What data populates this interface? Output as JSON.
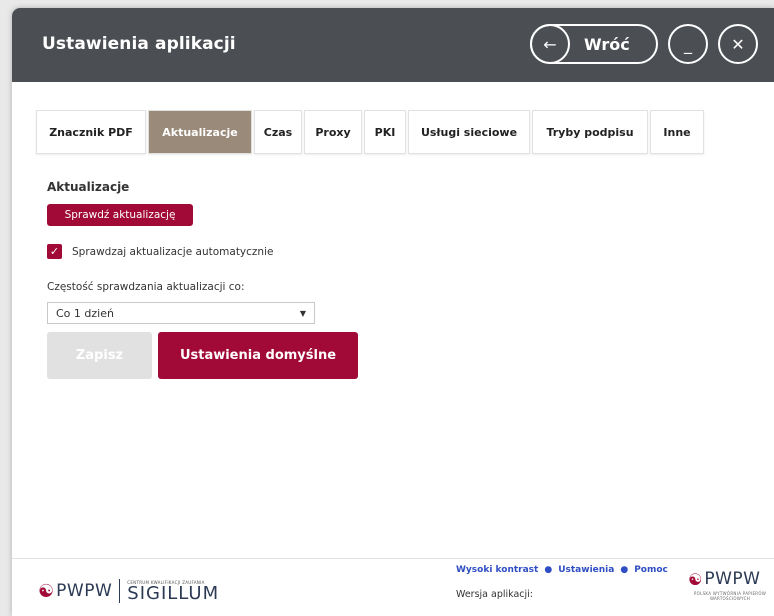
{
  "titlebar": {
    "title": "Ustawienia aplikacji",
    "back_label": "Wróć",
    "back_icon": "arrow-left-icon",
    "minimize_icon": "minimize-icon",
    "close_icon": "close-icon"
  },
  "tabs": [
    {
      "label": "Znacznik PDF",
      "active": false
    },
    {
      "label": "Aktualizacje",
      "active": true
    },
    {
      "label": "Czas",
      "active": false
    },
    {
      "label": "Proxy",
      "active": false
    },
    {
      "label": "PKI",
      "active": false
    },
    {
      "label": "Usługi sieciowe",
      "active": false
    },
    {
      "label": "Tryby podpisu",
      "active": false
    },
    {
      "label": "Inne",
      "active": false
    }
  ],
  "updates": {
    "section_title": "Aktualizacje",
    "check_button": "Sprawdź aktualizację",
    "auto_check_label": "Sprawdzaj aktualizacje automatycznie",
    "auto_check_checked": true,
    "frequency_label": "Częstość sprawdzania aktualizacji co:",
    "frequency_value": "Co 1 dzień"
  },
  "actions": {
    "save_label": "Zapisz",
    "defaults_label": "Ustawienia domyślne"
  },
  "footer": {
    "logo_left_main": "PWPW",
    "logo_left_small": "CENTRUM KWALIFIKACJI ZAUFANIA",
    "logo_left_sigillum": "SIGILLUM",
    "links": [
      "Wysoki kontrast",
      "Ustawienia",
      "Pomoc"
    ],
    "version_label": "Wersja aplikacji:",
    "logo_right_main": "PWPW",
    "logo_right_sub": "POLSKA WYTWÓRNIA PAPIERÓW WARTOŚCIOWYCH"
  },
  "colors": {
    "accent": "#a10a37",
    "titlebar": "#4b4f54",
    "active_tab": "#9a8a7a",
    "link": "#2f4ec4"
  }
}
